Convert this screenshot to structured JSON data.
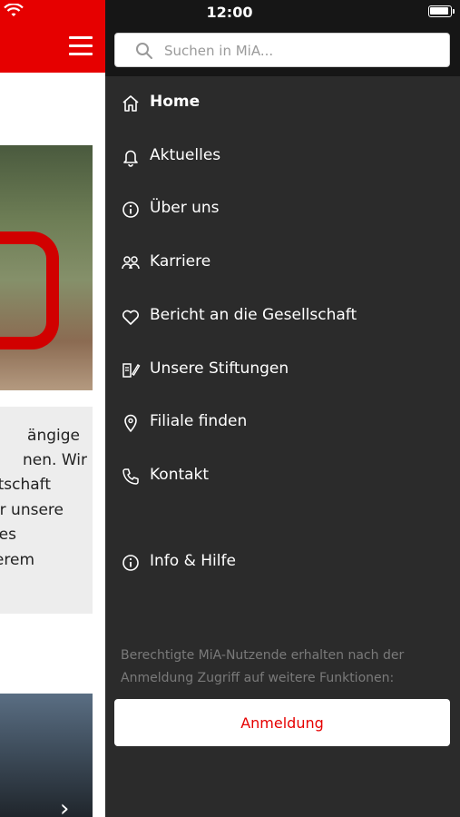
{
  "status_bar": {
    "time": "12:00"
  },
  "background_page": {
    "text_lines": [
      "ängige",
      "nen. Wir",
      "tschaft",
      "r unsere",
      "es",
      "erem"
    ]
  },
  "drawer": {
    "search": {
      "placeholder": "Suchen in MiA..."
    },
    "items": [
      {
        "label": "Home",
        "icon": "home-icon"
      },
      {
        "label": "Aktuelles",
        "icon": "bell-icon"
      },
      {
        "label": "Über uns",
        "icon": "info-icon"
      },
      {
        "label": "Karriere",
        "icon": "people-icon"
      },
      {
        "label": "Bericht an die Gesellschaft",
        "icon": "heart-icon"
      },
      {
        "label": "Unsere Stiftungen",
        "icon": "brush-icon"
      },
      {
        "label": "Filiale finden",
        "icon": "location-pin-icon"
      },
      {
        "label": "Kontakt",
        "icon": "phone-icon"
      }
    ],
    "help": {
      "label": "Info & Hilfe",
      "icon": "info-icon"
    },
    "login_info": "Berechtigte MiA-Nutzende erhalten nach der Anmeldung Zugriff auf weitere Funktionen:",
    "login_button": "Anmeldung"
  },
  "colors": {
    "brand_red": "#e60000",
    "drawer_bg": "#2b2b2b",
    "drawer_top": "#161616"
  }
}
